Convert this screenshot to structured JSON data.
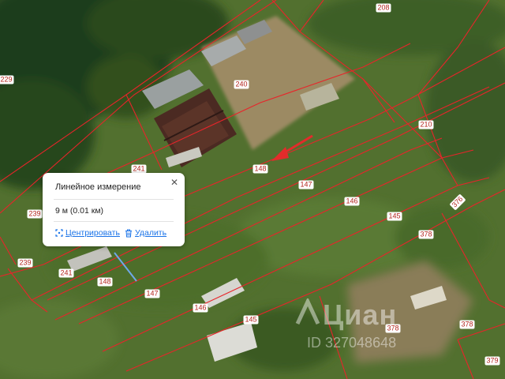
{
  "map": {
    "plot_labels": [
      "208",
      "229",
      "240",
      "210",
      "241",
      "148",
      "147",
      "146",
      "145",
      "239",
      "376",
      "378"
    ],
    "lower_labels": [
      "239",
      "241",
      "148",
      "147",
      "146",
      "145",
      "378",
      "378",
      "379"
    ],
    "direction_arrow_color": "#e32b2b",
    "boundary_color": "#e8242a",
    "measure_line_color": "#6fa8e8"
  },
  "popup": {
    "title": "Линейное измерение",
    "value": "9 м (0.01 км)",
    "center_label": "Центрировать",
    "delete_label": "Удалить",
    "close_icon": "close-icon"
  },
  "watermark": {
    "brand": "Циан",
    "id": "ID 327048648"
  }
}
